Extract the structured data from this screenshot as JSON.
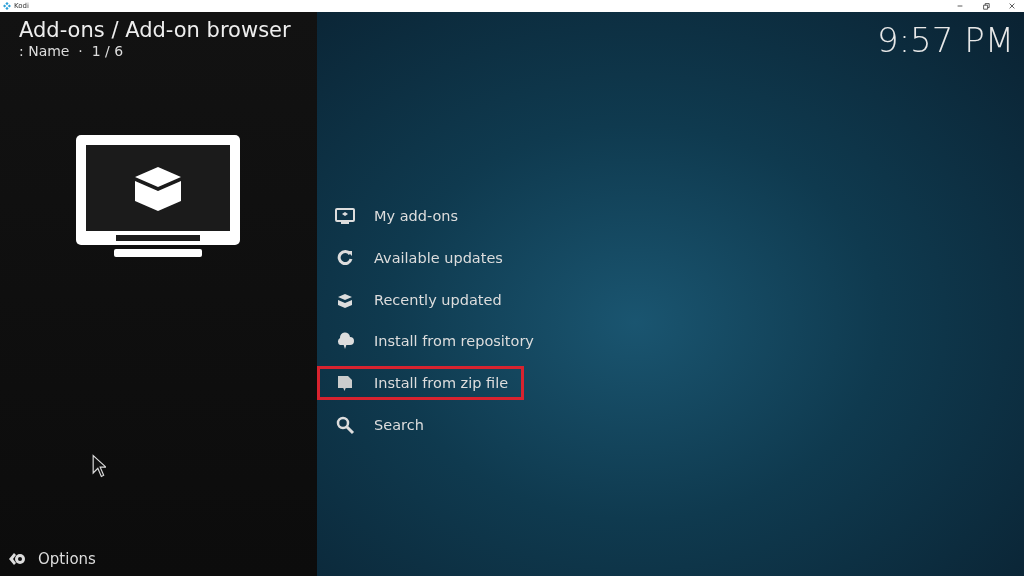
{
  "window": {
    "title": "Kodi"
  },
  "header": {
    "breadcrumb": "Add-ons / Add-on browser",
    "sort_info": ": Name  ·  1 / 6"
  },
  "clock": "9:57 PM",
  "menu": [
    {
      "label": "My add-ons",
      "kind": "monitor",
      "highlighted": false
    },
    {
      "label": "Available updates",
      "kind": "refresh",
      "highlighted": false
    },
    {
      "label": "Recently updated",
      "kind": "box",
      "highlighted": false
    },
    {
      "label": "Install from repository",
      "kind": "cloud",
      "highlighted": false
    },
    {
      "label": "Install from zip file",
      "kind": "zip",
      "highlighted": true
    },
    {
      "label": "Search",
      "kind": "search",
      "highlighted": false
    }
  ],
  "options": {
    "label": "Options"
  }
}
